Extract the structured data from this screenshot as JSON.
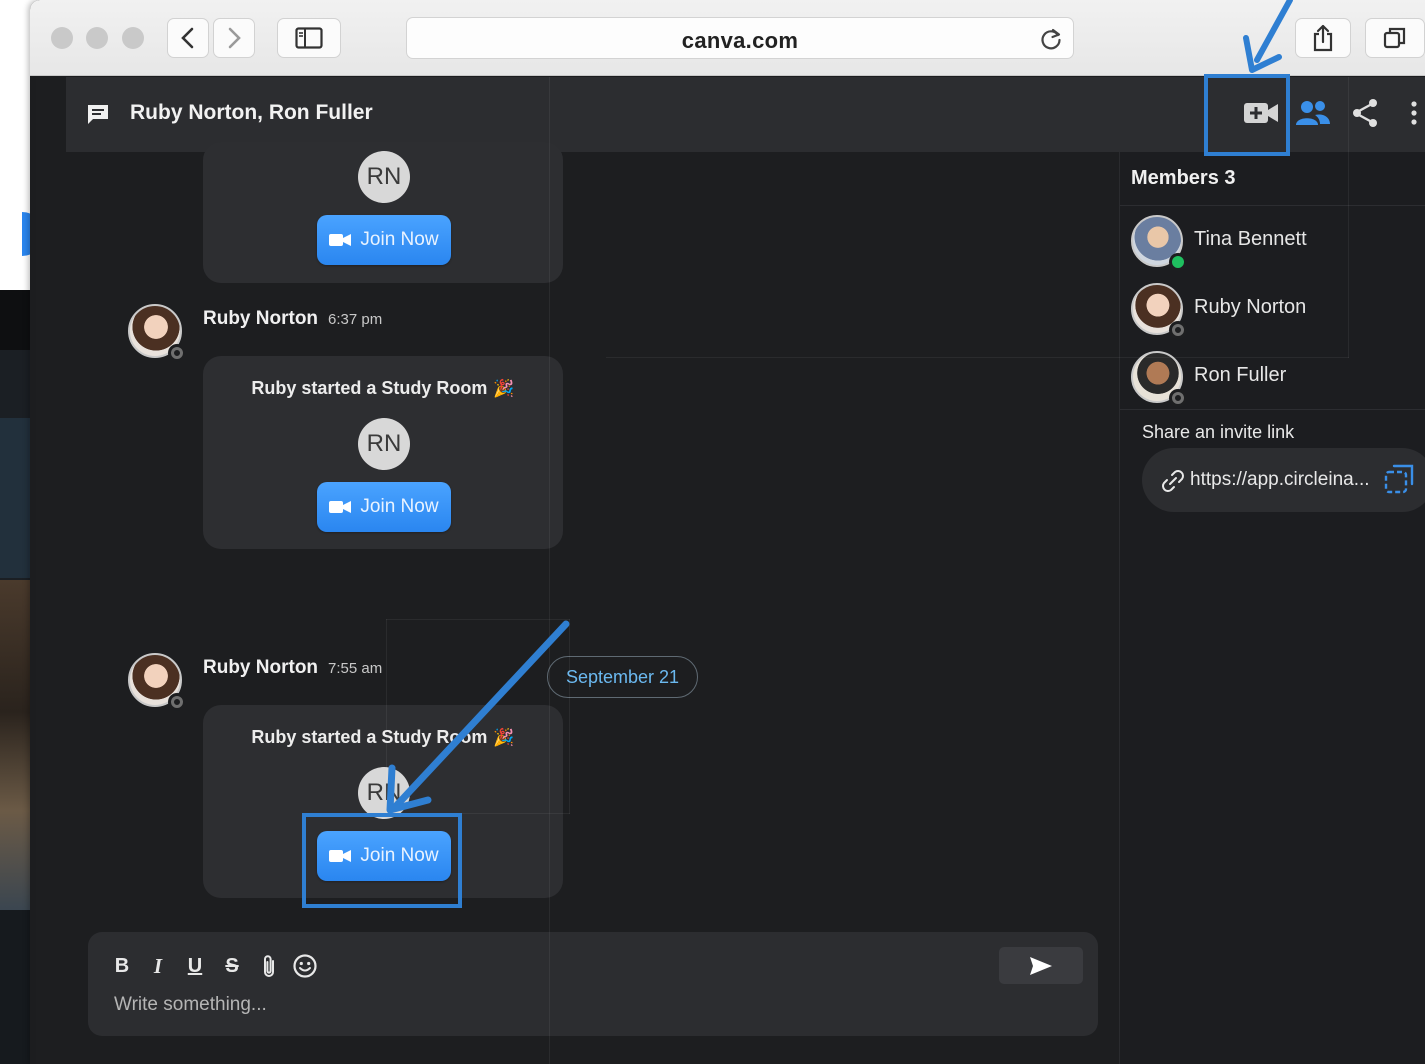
{
  "browser": {
    "url": "canva.com"
  },
  "chat": {
    "title": "Ruby Norton, Ron Fuller"
  },
  "messages": [
    {
      "initials": "RN",
      "join_label": "Join Now"
    },
    {
      "sender": "Ruby Norton",
      "time": "6:37 pm",
      "caption": "Ruby started a Study Room",
      "initials": "RN",
      "join_label": "Join Now"
    },
    {
      "sender": "Ruby Norton",
      "time": "7:55 am",
      "caption": "Ruby started a Study Room",
      "initials": "RN",
      "join_label": "Join Now"
    }
  ],
  "date_separator": "September 21",
  "composer": {
    "bold": "B",
    "italic": "I",
    "underline": "U",
    "strike": "S",
    "placeholder": "Write something..."
  },
  "sidebar": {
    "members_header": "Members 3",
    "members": [
      {
        "name": "Tina Bennett",
        "status": "online"
      },
      {
        "name": "Ruby Norton",
        "status": "offline"
      },
      {
        "name": "Ron Fuller",
        "status": "offline"
      }
    ],
    "invite_label": "Share an invite link",
    "invite_url": "https://app.circleina..."
  },
  "colors": {
    "accent": "#2a86f0",
    "annotation": "#2f7fd2",
    "online": "#1fbf5f",
    "date_text": "#6bb9f0"
  }
}
